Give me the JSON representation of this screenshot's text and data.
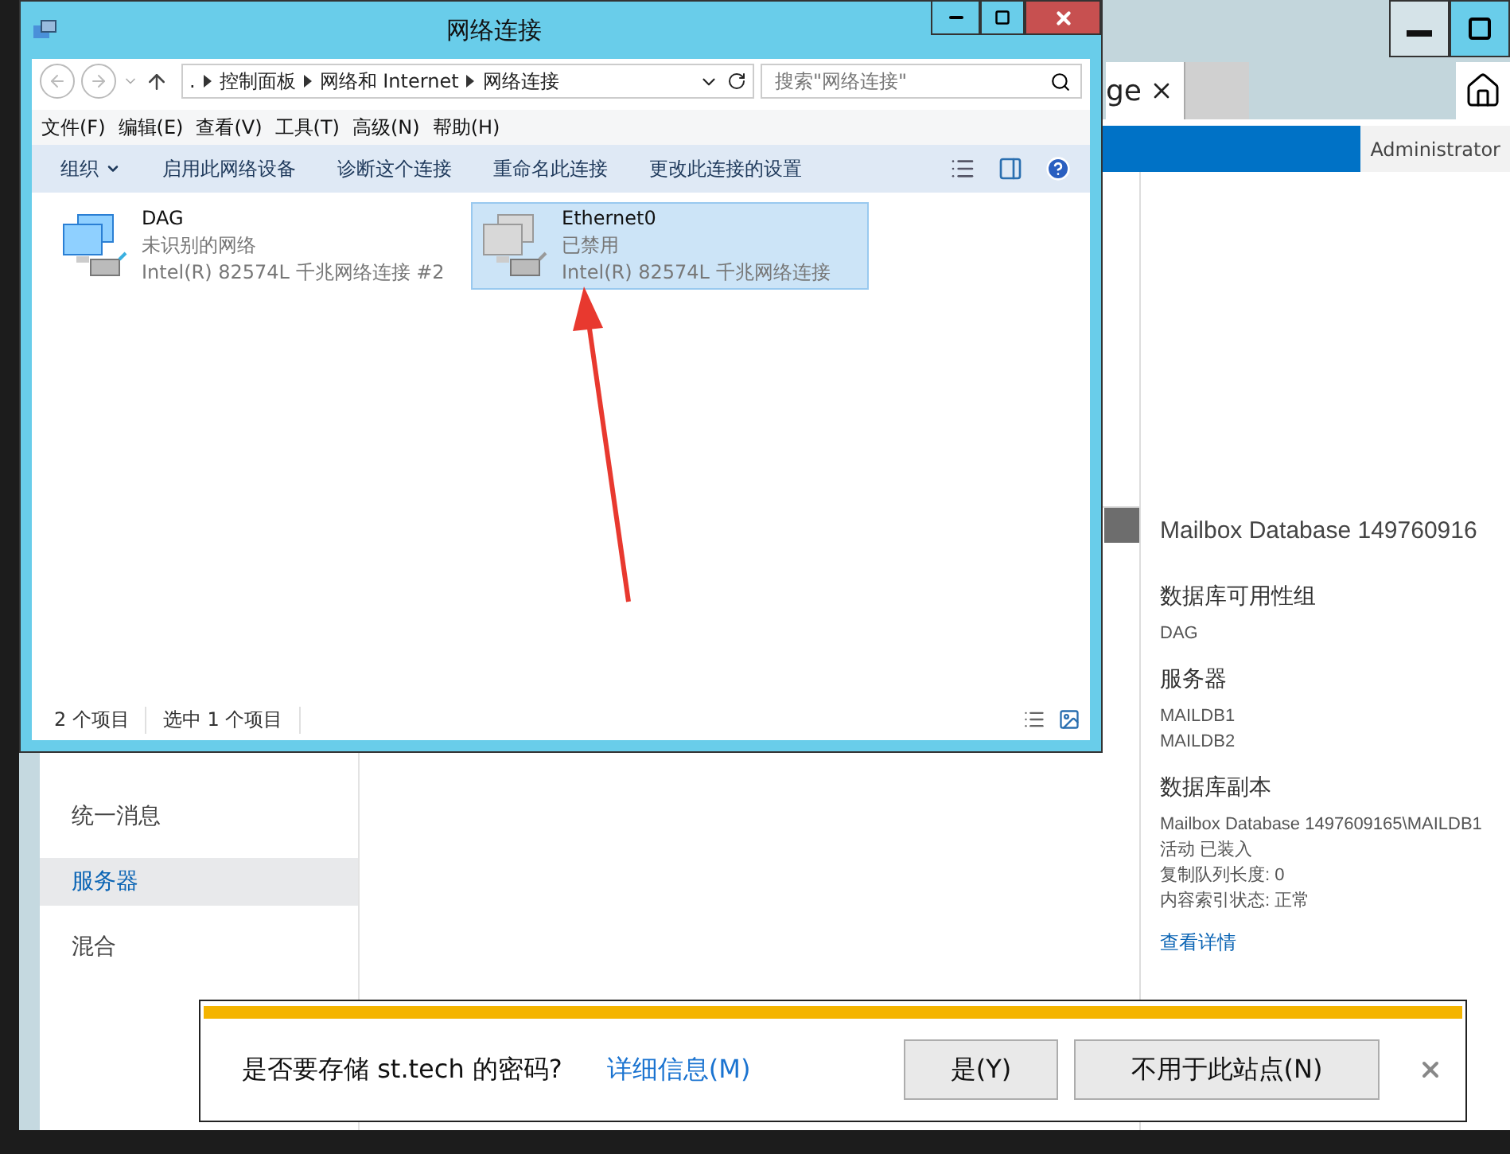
{
  "browser": {
    "tab": "ge",
    "user": "Administrator"
  },
  "explorer": {
    "title": "网络连接",
    "breadcrumb": [
      ".",
      "控制面板",
      "网络和 Internet",
      "网络连接"
    ],
    "search": {
      "placeholder": "搜索\"网络连接\""
    },
    "menu": [
      "文件(F)",
      "编辑(E)",
      "查看(V)",
      "工具(T)",
      "高级(N)",
      "帮助(H)"
    ],
    "commands": [
      {
        "label": "组织",
        "dropdown": true
      },
      {
        "label": "启用此网络设备",
        "dropdown": false
      },
      {
        "label": "诊断这个连接",
        "dropdown": false
      },
      {
        "label": "重命名此连接",
        "dropdown": false
      },
      {
        "label": "更改此连接的设置",
        "dropdown": false
      }
    ],
    "items": [
      {
        "name": "DAG",
        "status": "未识别的网络",
        "adapter": "Intel(R) 82574L 千兆网络连接 #2",
        "disabled": false,
        "selected": false
      },
      {
        "name": "Ethernet0",
        "status": "已禁用",
        "adapter": "Intel(R) 82574L 千兆网络连接",
        "disabled": true,
        "selected": true
      }
    ],
    "status": [
      "2 个项目",
      "选中 1 个项目"
    ]
  },
  "nav": [
    {
      "label": "统一消息",
      "selected": false
    },
    {
      "label": "服务器",
      "selected": true
    },
    {
      "label": "混合",
      "selected": false
    }
  ],
  "details": {
    "title": "Mailbox Database 149760916",
    "sections": [
      {
        "heading": "数据库可用性组",
        "lines": [
          "DAG"
        ]
      },
      {
        "heading": "服务器",
        "lines": [
          "MAILDB1",
          "MAILDB2"
        ]
      },
      {
        "heading": "数据库副本",
        "lines": [
          "Mailbox Database 1497609165\\MAILDB1",
          "活动 已装入",
          "复制队列长度: 0",
          "内容索引状态: 正常"
        ]
      }
    ],
    "link": "查看详情"
  },
  "password_bar": {
    "message": "是否要存储 st.tech 的密码?",
    "link": "详细信息(M)",
    "buttons": [
      "是(Y)",
      "不用于此站点(N)"
    ]
  }
}
